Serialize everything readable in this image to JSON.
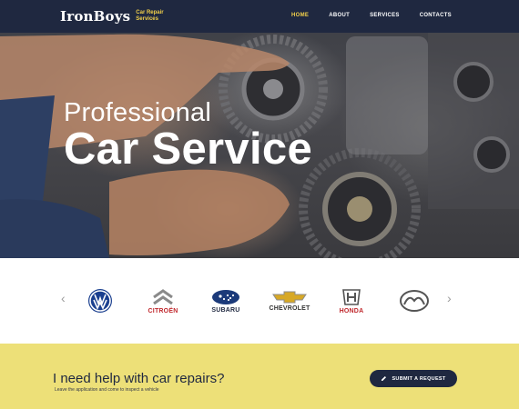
{
  "header": {
    "logo_main": "IronBoys",
    "logo_sub_line1": "Car Repair",
    "logo_sub_line2": "Services",
    "nav": [
      {
        "label": "HOME",
        "active": true
      },
      {
        "label": "ABOUT",
        "active": false
      },
      {
        "label": "SERVICES",
        "active": false
      },
      {
        "label": "CONTACTS",
        "active": false
      }
    ]
  },
  "hero": {
    "line1": "Professional",
    "line2": "Car Service"
  },
  "brands": {
    "prev_icon": "chevron-left-icon",
    "next_icon": "chevron-right-icon",
    "items": [
      {
        "name": "volkswagen",
        "label": ""
      },
      {
        "name": "citroen",
        "label": "CITROËN"
      },
      {
        "name": "subaru",
        "label": "SUBARU"
      },
      {
        "name": "chevrolet",
        "label": "CHEVROLET"
      },
      {
        "name": "honda",
        "label": "HONDA"
      },
      {
        "name": "mazda",
        "label": ""
      }
    ]
  },
  "cta": {
    "title": "I need help with car repairs?",
    "subtitle": "Leave the application and come to inspect a vehicle",
    "button_label": "SUBMIT A REQUEST",
    "button_icon": "pencil-icon"
  },
  "colors": {
    "navy": "#1f2840",
    "accent_yellow": "#f2d04a",
    "cta_background": "#ede078"
  }
}
